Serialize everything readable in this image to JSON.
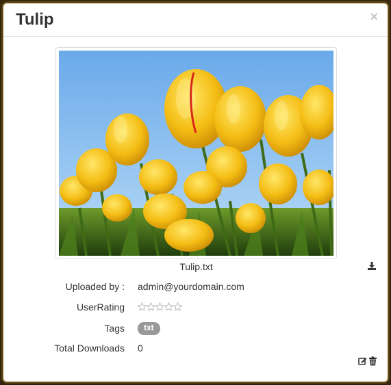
{
  "modal": {
    "title": "Tulip",
    "close_label": "×"
  },
  "file": {
    "name": "Tulip.txt",
    "image_icon": "tulip-photo"
  },
  "details": {
    "uploaded_by_label": "Uploaded by :",
    "uploaded_by_value": "admin@yourdomain.com",
    "rating_label": "UserRating",
    "rating_value": 0,
    "rating_max": 5,
    "tags_label": "Tags",
    "tags": [
      "txt"
    ],
    "downloads_label": "Total Downloads",
    "downloads_value": "0"
  },
  "icons": {
    "download": "download-icon",
    "edit": "edit-icon",
    "delete": "trash-icon"
  },
  "colors": {
    "tag_bg": "#999999",
    "title": "#333333",
    "sky": "#7fb8ee",
    "petal": "#f5c21a"
  }
}
